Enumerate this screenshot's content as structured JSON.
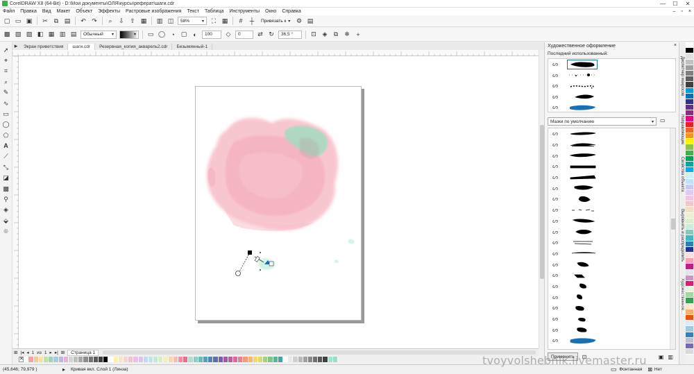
{
  "titlebar": {
    "title": "CorelDRAW X8 (64-Bit) - D:\\Мои документы\\ОЛЯ\\курсы\\реферат\\шаги.cdr",
    "minimize": "—",
    "maximize": "☐",
    "close": "✕"
  },
  "menu": {
    "items": [
      "Файл",
      "Правка",
      "Вид",
      "Макет",
      "Объект",
      "Эффекты",
      "Растровые изображения",
      "Текст",
      "Таблица",
      "Инструменты",
      "Окно",
      "Справка"
    ],
    "right_controls": [
      "–",
      "▫",
      "×"
    ]
  },
  "toolbar1": {
    "zoom_value": "58%",
    "snap_label": "Привязать к"
  },
  "toolbar2": {
    "blend_mode": "Обычный",
    "transparency_value": "100",
    "feather_value": "0",
    "angle_value": "36,5 °"
  },
  "doc_tabs": [
    "Экран приветствия",
    "шаги.cdr",
    "Резервная_копия_акварель2.cdr",
    "Безымянный-1"
  ],
  "active_tab_index": 1,
  "docker": {
    "title": "Художественное оформление",
    "recent_label": "Последний использованный:",
    "preset_name": "Мазки по умолчанию",
    "apply_label": "Применить",
    "side_tabs": [
      "Диспетчер макросов",
      "Направляющие",
      "Свойства объекта",
      "Выровнять и распределить",
      "Художественное..."
    ]
  },
  "page_nav": {
    "current": "1",
    "of_label": "из",
    "total": "1",
    "page_tab": "Страница 1"
  },
  "status": {
    "coords": "(45,646; 79,979 )",
    "object_info": "Кривая вкл. Слой 1 (Линза)",
    "fill_label": "Фонтанная",
    "outline_label": "Нет"
  },
  "watermark": "tvoyvolshebnik.livemaster.ru",
  "colors": {
    "accent_blue": "#1a6fb5",
    "pink_splash": "#f7b6c2",
    "mint_splash": "#9fdcc0"
  },
  "palette_horizontal": [
    "#ffffff",
    "#f4a2a8",
    "#f6c9a4",
    "#f9e2a0",
    "#c4e0a4",
    "#9fd3b9",
    "#a4cde3",
    "#c0b4e0",
    "#e3b4d6",
    "#d4d4d4",
    "#bfbfbf",
    "#a6a6a6",
    "#8c8c8c",
    "#737373",
    "#595959",
    "#404040",
    "#000000",
    "#ffffff",
    "#fff1a8",
    "#fbe3c8",
    "#fbd0d6",
    "#f5c0cf",
    "#ecc0e0",
    "#d9c7ea",
    "#c6d8f0",
    "#bfe4ea",
    "#c3ead6",
    "#d8efc0",
    "#f3f0bd",
    "#f7d7b0",
    "#f4bcbc",
    "#f28ca0",
    "#e76f8a",
    "#b0dfcf",
    "#8ad0c2",
    "#66bfbd",
    "#4fa4b9",
    "#4e86b6",
    "#5a6db0",
    "#7a5fad",
    "#9e5aa6",
    "#c05d9f",
    "#e06697",
    "#ee7f8d",
    "#f49a7f",
    "#f6b871",
    "#f7d46a",
    "#d7dc6b",
    "#a8d07a",
    "#7fc48a",
    "#5cb596",
    "#46a49f",
    "#ffffff",
    "#e8e8e8",
    "#d0d0d0",
    "#b8b8b8",
    "#a0a0a0",
    "#888888",
    "#707070",
    "#585858",
    "#404040",
    "#9fe4d0",
    "#a0dcc4"
  ],
  "palette_vertical": [
    "#ffffff",
    "#000000",
    "#e0e0e0",
    "#c0c0c0",
    "#a0a0a0",
    "#808080",
    "#606060",
    "#404040",
    "#00a0e0",
    "#0070c0",
    "#2e3192",
    "#662d91",
    "#92278f",
    "#ec008c",
    "#ed1c24",
    "#f26522",
    "#f7941d",
    "#fff200",
    "#8dc63f",
    "#39b54a",
    "#00a651",
    "#00a99d",
    "#00aeef",
    "#d0f0f0",
    "#c0e0ff",
    "#c8c8f0",
    "#e0c8f0",
    "#f0c8e0",
    "#f0c8c8",
    "#f0e0c8",
    "#f0f0c8",
    "#d8f0c8",
    "#c8f0d8",
    "#7fcdbb",
    "#41b6c4",
    "#2c7fb8",
    "#253494",
    "#fde0dd",
    "#fa9fb5",
    "#c51b8a",
    "#e7e1ef",
    "#c994c7",
    "#dd1c77",
    "#e5f5e0",
    "#a1d99b",
    "#31a354",
    "#fee6ce",
    "#fdae6b",
    "#e6550d",
    "#deebf7",
    "#9ecae1",
    "#3182bd",
    "#bcbddc",
    "#756bb1",
    "#d9d9d9"
  ]
}
